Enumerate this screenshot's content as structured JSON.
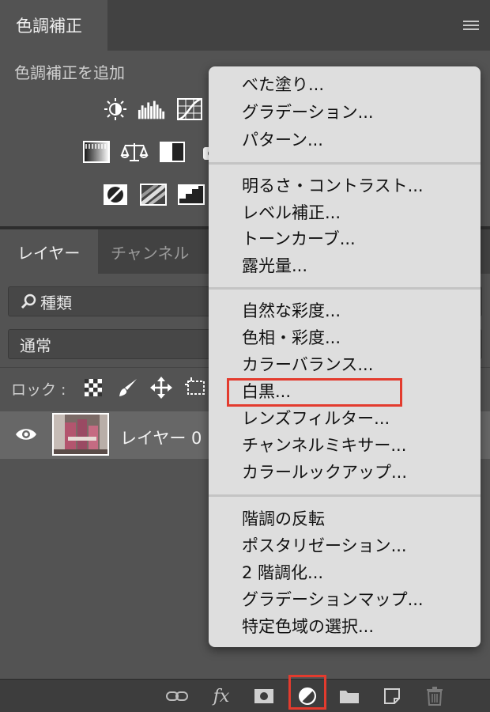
{
  "adjustments_panel": {
    "tab_label": "色調補正",
    "subtitle": "色調補正を追加",
    "icons": [
      "brightness-contrast-icon",
      "levels-icon",
      "curves-icon",
      "exposure-icon",
      "gradient-map-icon",
      "color-balance-icon",
      "black-white-icon",
      "photo-filter-icon",
      "invert-icon",
      "posterize-icon",
      "threshold-icon"
    ]
  },
  "layers_panel": {
    "tabs": [
      "レイヤー",
      "チャンネル"
    ],
    "filter_label": "種類",
    "blend_mode": "通常",
    "lock_label": "ロック :",
    "layer_name": "レイヤー 0"
  },
  "bottom_bar": {
    "icons": [
      "link-icon",
      "fx-icon",
      "mask-icon",
      "adjustment-layer-icon",
      "folder-icon",
      "new-layer-icon",
      "trash-icon"
    ],
    "fx_label": "fx"
  },
  "menu": {
    "groups": [
      [
        "べた塗り...",
        "グラデーション...",
        "パターン..."
      ],
      [
        "明るさ・コントラスト...",
        "レベル補正...",
        "トーンカーブ...",
        "露光量..."
      ],
      [
        "自然な彩度...",
        "色相・彩度...",
        "カラーバランス...",
        "白黒...",
        "レンズフィルター...",
        "チャンネルミキサー...",
        "カラールックアップ..."
      ],
      [
        "階調の反転",
        "ポスタリゼーション...",
        "2 階調化...",
        "グラデーションマップ...",
        "特定色域の選択..."
      ]
    ]
  },
  "colors": {
    "highlight_border": "#e33b2e",
    "menu_background": "#dedede",
    "panel_background": "#535353"
  }
}
